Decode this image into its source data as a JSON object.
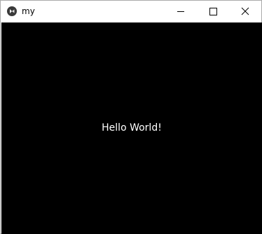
{
  "window": {
    "title": "my",
    "icon": "kivy-app-icon",
    "controls": {
      "minimize_icon": "minimize-icon",
      "maximize_icon": "maximize-icon",
      "close_icon": "close-icon"
    }
  },
  "content": {
    "label": "Hello World!",
    "background_color": "#000000",
    "text_color": "#ffffff"
  }
}
